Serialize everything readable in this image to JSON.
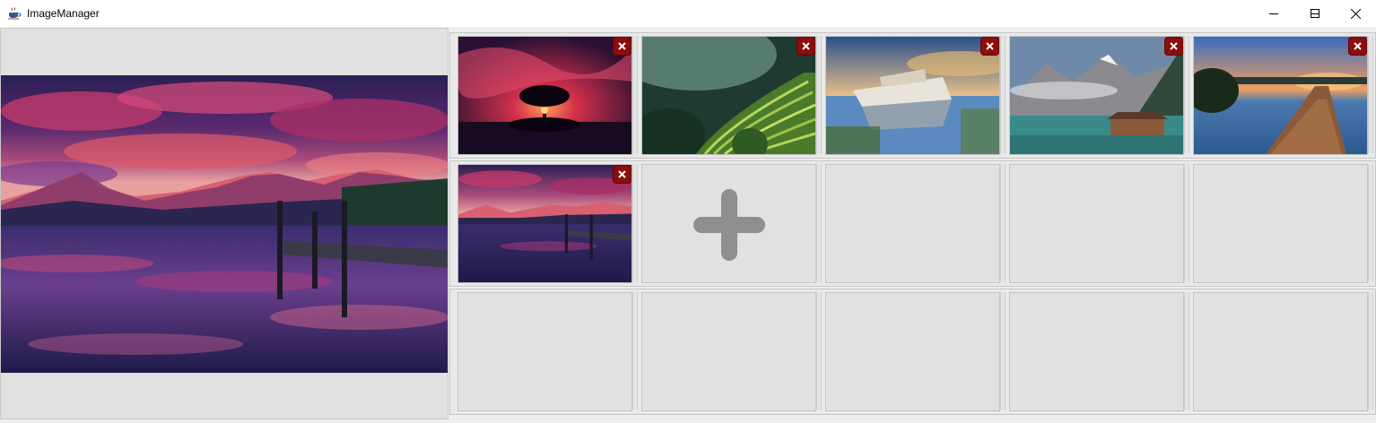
{
  "window": {
    "title": "ImageManager",
    "app_icon": "coffee-cup-icon",
    "controls": [
      "minimize-icon",
      "maximize-icon",
      "close-icon"
    ]
  },
  "preview": {
    "image": "lake-mountains-sunset-dock"
  },
  "grid": {
    "columns": 5,
    "rows": 3,
    "cells": [
      {
        "kind": "image",
        "image": "tree-sunset-red-sky",
        "remove_icon": "remove-icon"
      },
      {
        "kind": "image",
        "image": "rice-terraces-green",
        "remove_icon": "remove-icon"
      },
      {
        "kind": "image",
        "image": "shipwreck-lake",
        "remove_icon": "remove-icon"
      },
      {
        "kind": "image",
        "image": "mountain-lake-boathouse",
        "remove_icon": "remove-icon"
      },
      {
        "kind": "image",
        "image": "wooden-pier-sunset",
        "remove_icon": "remove-icon"
      },
      {
        "kind": "image",
        "image": "lake-mountains-sunset-dock",
        "remove_icon": "remove-icon",
        "selected": true
      },
      {
        "kind": "add",
        "icon": "plus-icon"
      },
      {
        "kind": "empty"
      },
      {
        "kind": "empty"
      },
      {
        "kind": "empty"
      },
      {
        "kind": "empty"
      },
      {
        "kind": "empty"
      },
      {
        "kind": "empty"
      },
      {
        "kind": "empty"
      },
      {
        "kind": "empty"
      }
    ]
  },
  "colors": {
    "remove_button": "#8b0d0d",
    "plus_icon": "#8e8e8e",
    "panel_bg": "#e1e1e1"
  }
}
